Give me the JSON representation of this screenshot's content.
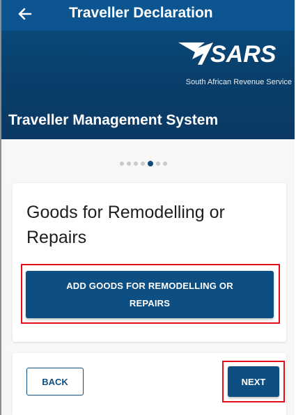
{
  "appbar": {
    "title": "Traveller Declaration",
    "back_icon": "arrow-left-icon"
  },
  "banner": {
    "logo_text": "SARS",
    "tagline": "South African Revenue Service",
    "system_name": "Traveller Management System"
  },
  "stepper": {
    "total_steps": 7,
    "current_step": 5
  },
  "section": {
    "title": "Goods for Remodelling or Repairs",
    "add_button_label": "ADD GOODS FOR REMODELLING OR REPAIRS"
  },
  "navigation": {
    "back_label": "BACK",
    "next_label": "NEXT"
  },
  "colors": {
    "brand_blue": "#0d4f82",
    "header_blue": "#0a3f6b",
    "highlight_red": "#e0101a"
  }
}
